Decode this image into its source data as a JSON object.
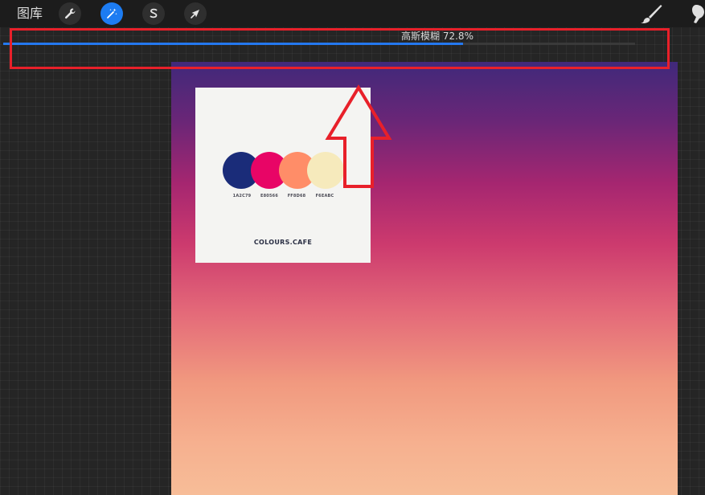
{
  "toolbar": {
    "gallery_label": "图库",
    "tools": [
      {
        "name": "wrench-icon"
      },
      {
        "name": "magic-wand-icon",
        "active": true
      },
      {
        "name": "selection-icon"
      },
      {
        "name": "arrow-cursor-icon"
      }
    ],
    "right_tools": [
      "brush-icon",
      "smudge-icon"
    ]
  },
  "progress": {
    "label": "高斯模糊 72.8%",
    "value": 0.728
  },
  "palette_card": {
    "swatches": [
      {
        "color": "#1A2C79",
        "code": "1A2C79"
      },
      {
        "color": "#E80566",
        "code": "E80566"
      },
      {
        "color": "#FF8D68",
        "code": "FF8D68"
      },
      {
        "color": "#F6EABC",
        "code": "F6EABC"
      }
    ],
    "brand": "COLOURS.CAFE"
  },
  "annotation": {
    "box_color": "#e8202a",
    "arrow_color": "#e8202a"
  }
}
